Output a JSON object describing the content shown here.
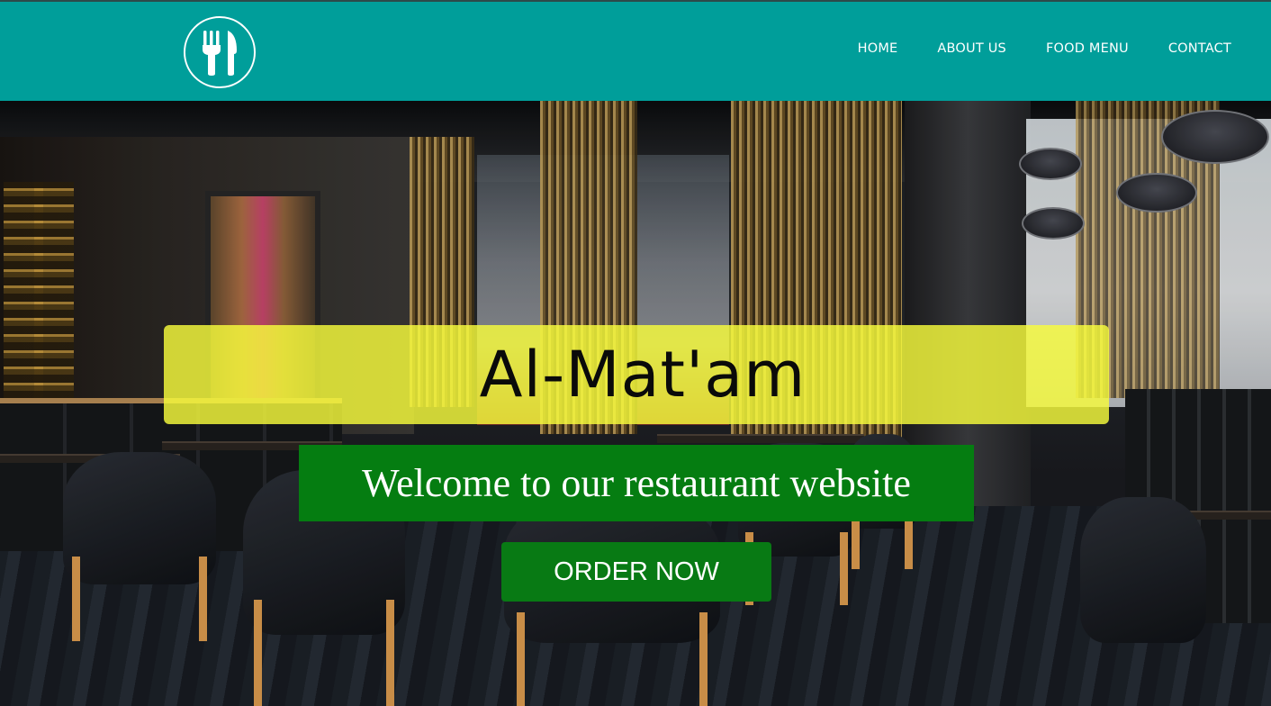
{
  "header": {
    "logo_icon": "fork-knife-icon",
    "background_color": "#009e9a"
  },
  "nav": {
    "items": [
      {
        "label": "HOME"
      },
      {
        "label": "ABOUT US"
      },
      {
        "label": "FOOD MENU"
      },
      {
        "label": "CONTACT"
      }
    ]
  },
  "hero": {
    "title": "Al-Mat'am",
    "subtitle": "Welcome to our restaurant website",
    "cta_label": "ORDER NOW",
    "title_box_color": "#f8fc3c",
    "subtitle_box_color": "#057d11",
    "cta_color": "#087a14"
  }
}
